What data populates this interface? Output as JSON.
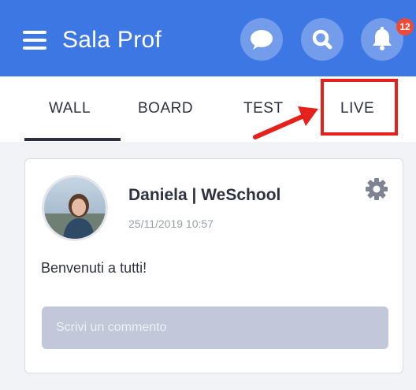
{
  "header": {
    "title": "Sala Prof",
    "notification_count": "12",
    "icons": [
      "menu-icon",
      "chat-icon",
      "search-icon",
      "bell-icon"
    ],
    "color": "#3d77e4"
  },
  "tabs": [
    {
      "label": "WALL",
      "active": true
    },
    {
      "label": "BOARD",
      "active": false
    },
    {
      "label": "TEST",
      "active": false
    },
    {
      "label": "LIVE",
      "active": false
    }
  ],
  "annotation": {
    "highlight_color": "#e5211c",
    "target": "LIVE"
  },
  "post": {
    "author": "Daniela | WeSchool",
    "timestamp": "25/11/2019 10:57",
    "text": "Benvenuti a tutti!",
    "comment_placeholder": "Scrivi un commento"
  }
}
